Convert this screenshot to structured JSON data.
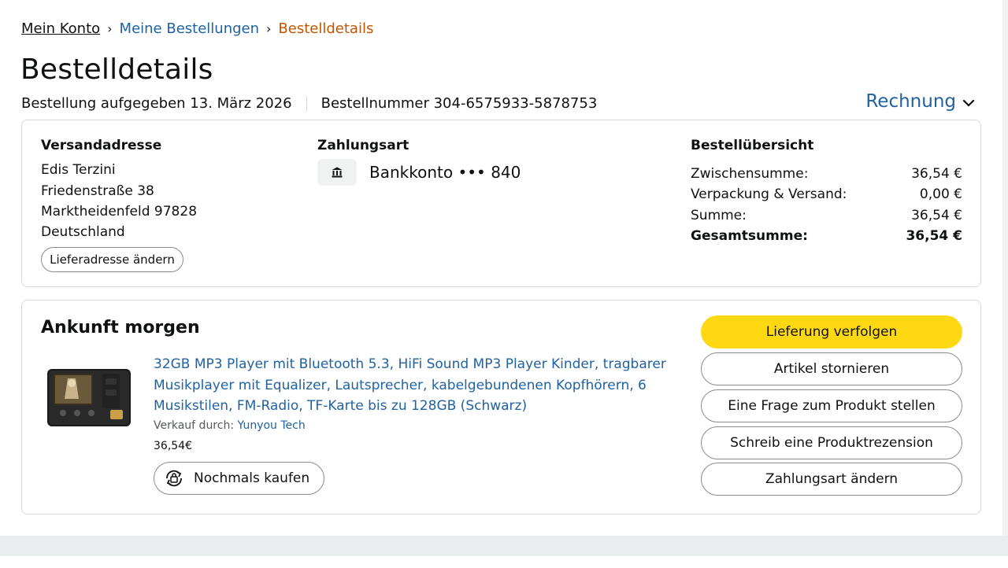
{
  "breadcrumb": {
    "items": [
      "Mein Konto",
      "Meine Bestellungen",
      "Bestelldetails"
    ],
    "separator": "›"
  },
  "page_title": "Bestelldetails",
  "order_meta": {
    "placed": "Bestellung aufgegeben 13. März 2026",
    "number": "Bestellnummer 304-6575933-5878753"
  },
  "invoice_label": "Rechnung",
  "shipping": {
    "heading": "Versandadresse",
    "lines": [
      "Edis Terzini",
      "Friedenstraße 38",
      "Marktheidenfeld 97828",
      "Deutschland"
    ],
    "change_button": "Lieferadresse ändern"
  },
  "payment": {
    "heading": "Zahlungsart",
    "method": "Bankkonto ••• 840",
    "icon": "bank-icon"
  },
  "summary": {
    "heading": "Bestellübersicht",
    "rows": [
      {
        "label": "Zwischensumme:",
        "value": "36,54 €"
      },
      {
        "label": "Verpackung & Versand:",
        "value": "0,00 €"
      },
      {
        "label": "Summe:",
        "value": "36,54 €"
      },
      {
        "label": "Gesamtsumme:",
        "value": "36,54 €"
      }
    ]
  },
  "shipment": {
    "arrival": "Ankunft morgen",
    "product_title": "32GB MP3 Player mit Bluetooth 5.3, HiFi Sound MP3 Player Kinder, tragbarer Musikplayer mit Equalizer, Lautsprecher, kabelgebundenen Kopfhörern, 6 Musikstilen, FM-Radio, TF-Karte bis zu 128GB (Schwarz)",
    "seller_prefix": "Verkauf durch:",
    "seller_name": "Yunyou Tech",
    "price": "36,54€",
    "buy_again": "Nochmals kaufen"
  },
  "actions": [
    "Lieferung verfolgen",
    "Artikel stornieren",
    "Eine Frage zum Produkt stellen",
    "Schreib eine Produktrezension",
    "Zahlungsart ändern"
  ],
  "colors": {
    "link": "#2162a1",
    "active_crumb": "#c45500",
    "primary_button": "#ffd814",
    "border": "#d5d9d9"
  }
}
